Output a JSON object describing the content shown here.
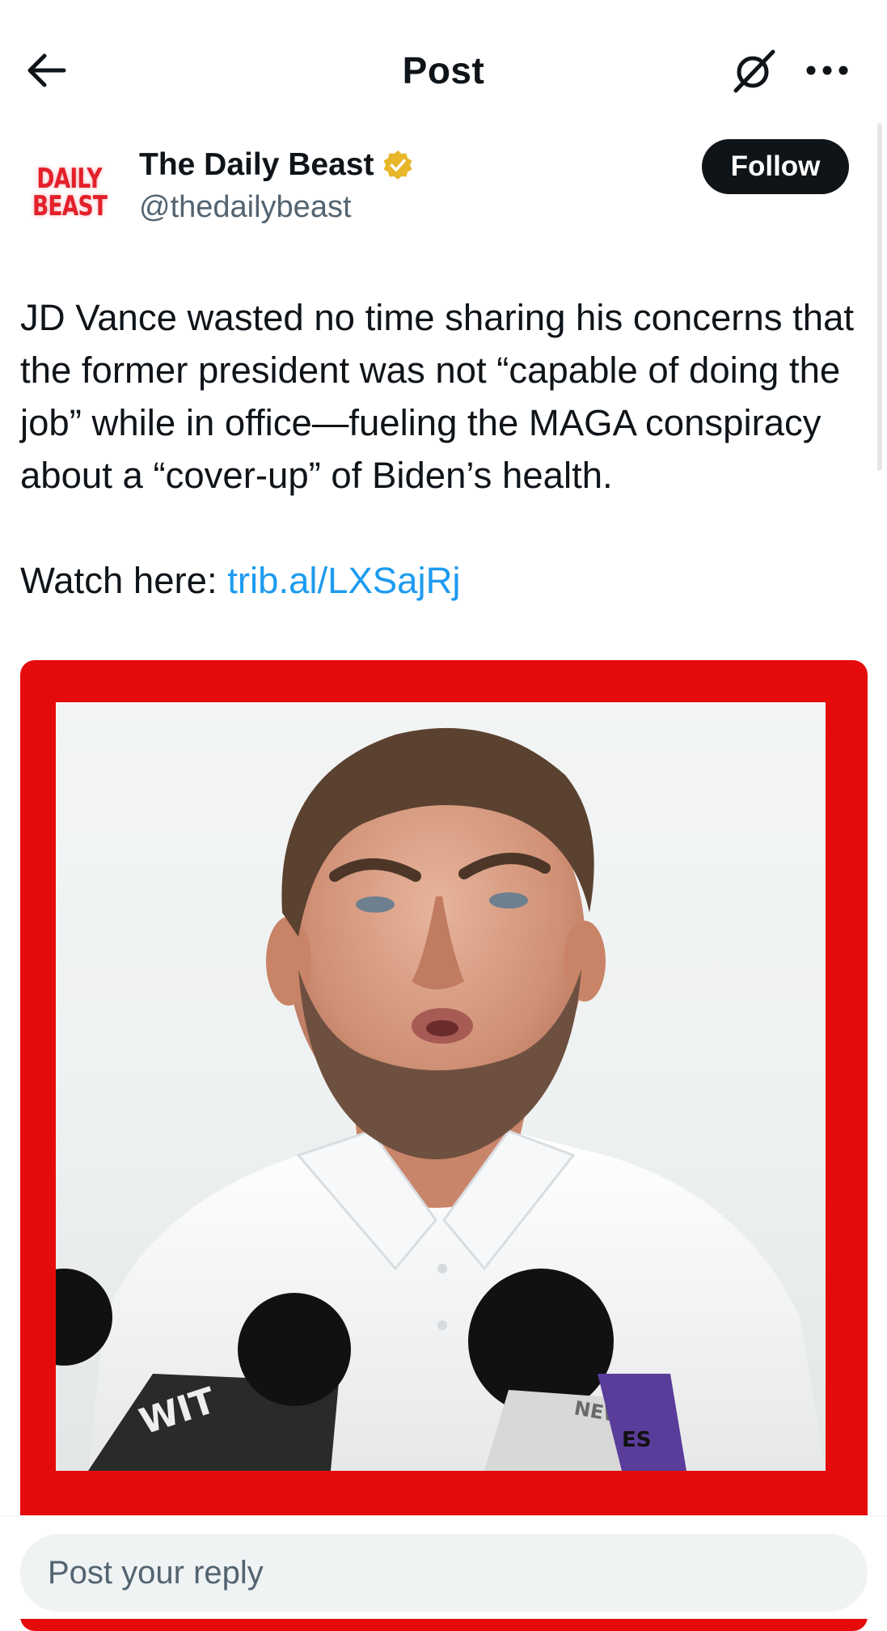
{
  "header": {
    "title": "Post",
    "back_icon": "arrow-left-icon",
    "grok_icon": "grok-icon",
    "more_icon": "more-horizontal-icon"
  },
  "author": {
    "logo_line1": "DAILY",
    "logo_line2": "BEAST",
    "name": "The Daily Beast",
    "handle": "@thedailybeast",
    "verified": "gold-verified-icon",
    "follow_label": "Follow"
  },
  "post": {
    "paragraph": "JD Vance wasted no time sharing his concerns that the former president was not “capable of doing the job” while in office—fueling the MAGA conspiracy about a “cover-up” of Biden’s health.",
    "watch_prefix": "Watch here: ",
    "link_text": "trib.al/LXSajRj"
  },
  "media": {
    "frame_color": "#e50b0b",
    "mic_label_1": "WIT",
    "mic_label_2": "NEWS",
    "mic_label_3": "ES"
  },
  "composer": {
    "placeholder": "Post your reply"
  },
  "colors": {
    "text": "#0f1419",
    "secondary": "#536471",
    "link": "#1d9bf0",
    "verified": "#e8b62a"
  }
}
